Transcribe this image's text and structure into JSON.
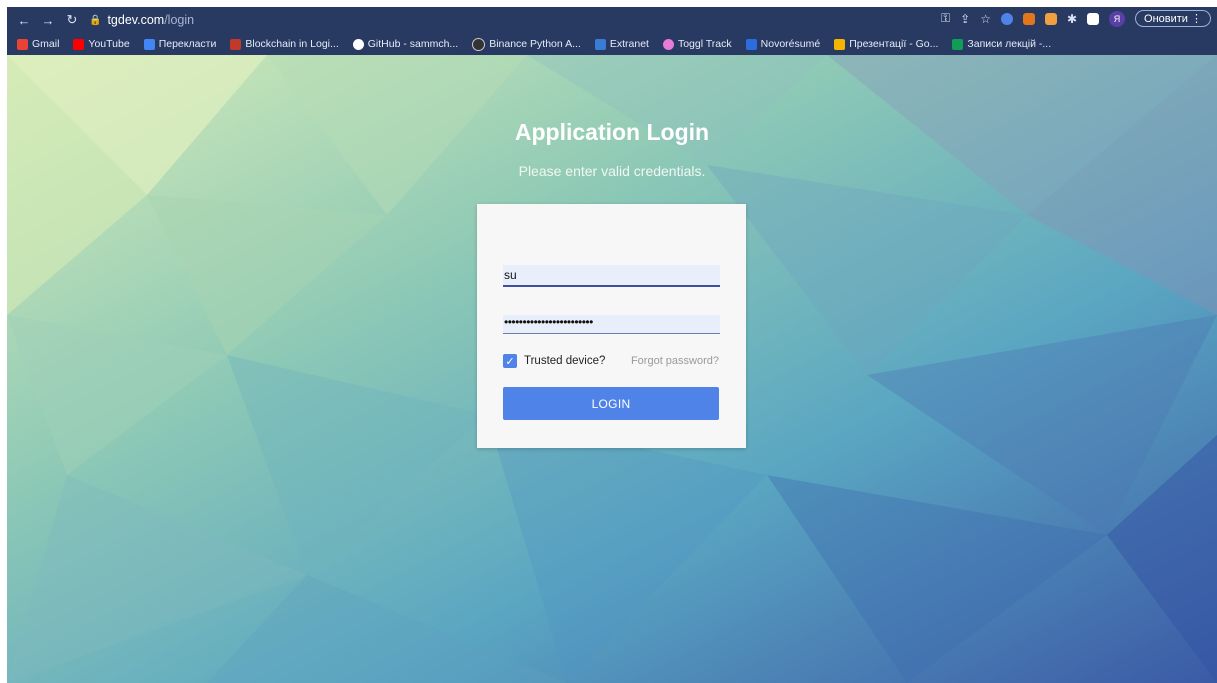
{
  "browser": {
    "url_host": "tgdev.com",
    "url_path": "/login",
    "update_label": "Оновити",
    "avatar_letter": "Я"
  },
  "bookmarks": [
    {
      "label": "Gmail",
      "color": "#ea4335"
    },
    {
      "label": "YouTube",
      "color": "#ff0000"
    },
    {
      "label": "Перекласти",
      "color": "#4285f4"
    },
    {
      "label": "Blockchain in Logi...",
      "color": "#c0392b"
    },
    {
      "label": "GitHub - sammch...",
      "color": "#ffffff"
    },
    {
      "label": "Binance Python A...",
      "color": "#333333"
    },
    {
      "label": "Extranet",
      "color": "#3a7bd5"
    },
    {
      "label": "Toggl Track",
      "color": "#e57cd8"
    },
    {
      "label": "Novorésumé",
      "color": "#2d6cdf"
    },
    {
      "label": "Презентації - Go...",
      "color": "#f4b400"
    },
    {
      "label": "Записи лекцій -...",
      "color": "#0f9d58"
    }
  ],
  "page": {
    "title": "Application Login",
    "subtitle": "Please enter valid credentials."
  },
  "form": {
    "username_value": "su",
    "password_value": "••••••••••••••••••••••••",
    "trusted_label": "Trusted device?",
    "trusted_checked": true,
    "forgot_label": "Forgot password?",
    "login_label": "LOGIN"
  },
  "colors": {
    "accent": "#4f83e8",
    "browser_bar": "#283962"
  }
}
